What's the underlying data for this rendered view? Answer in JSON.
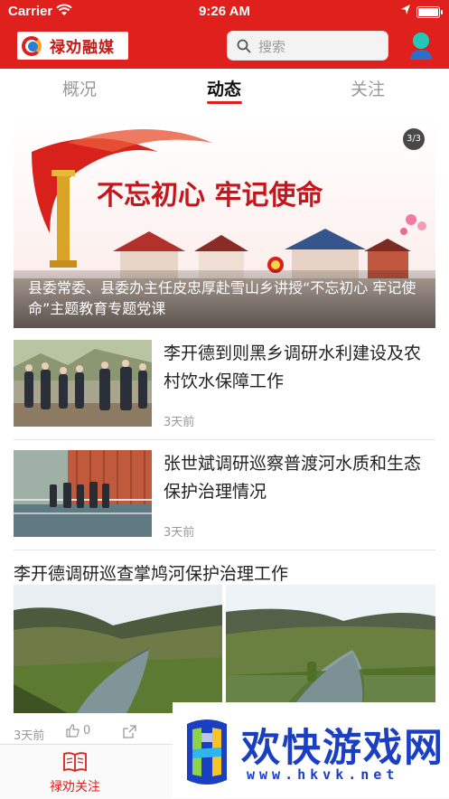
{
  "status_bar": {
    "carrier": "Carrier",
    "time": "9:26 AM"
  },
  "header": {
    "logo_text": "禄劝融媒",
    "search_placeholder": "搜索"
  },
  "tabs": [
    {
      "label": "概况",
      "active": false
    },
    {
      "label": "动态",
      "active": true
    },
    {
      "label": "关注",
      "active": false
    }
  ],
  "banner": {
    "page_indicator": "3/3",
    "slogan": "不忘初心 牢记使命",
    "caption": "县委常委、县委办主任皮忠厚赴雪山乡讲授“不忘初心 牢记使命”主题教育专题党课"
  },
  "news": [
    {
      "title": "李开德到则黑乡调研水利建设及农村饮水保障工作",
      "time": "3天前"
    },
    {
      "title": "张世斌调研巡察普渡河水质和生态保护治理情况",
      "time": "3天前"
    }
  ],
  "multi_post": {
    "title": "李开德调研巡查掌鸠河保护治理工作",
    "time": "3天前",
    "likes": "0"
  },
  "bottom_nav": {
    "label": "禄劝关注"
  },
  "watermark": {
    "title": "欢快游戏网",
    "url": "www.hkvk.net"
  },
  "colors": {
    "brand_red": "#e0201c",
    "watermark_blue": "#1a3fc2"
  }
}
